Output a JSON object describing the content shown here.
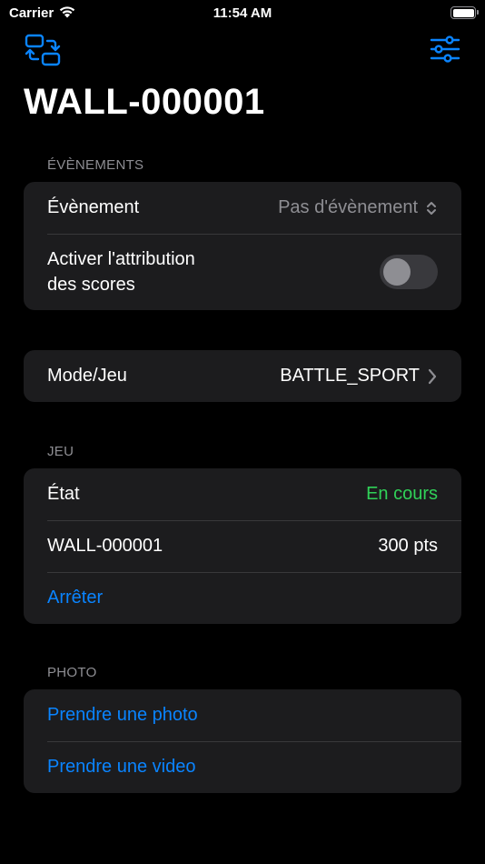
{
  "status_bar": {
    "carrier": "Carrier",
    "time": "11:54 AM"
  },
  "header": {
    "title": "WALL-000001"
  },
  "events": {
    "section_title": "ÉVÈNEMENTS",
    "event_label": "Évènement",
    "event_value": "Pas d'évènement",
    "scoring_label_line1": "Activer l'attribution",
    "scoring_label_line2": "des scores",
    "scoring_enabled": false
  },
  "mode": {
    "label": "Mode/Jeu",
    "value": "BATTLE_SPORT"
  },
  "game": {
    "section_title": "JEU",
    "state_label": "État",
    "state_value": "En cours",
    "wall_label": "WALL-000001",
    "wall_score": "300 pts",
    "stop_action": "Arrêter"
  },
  "photo": {
    "section_title": "PHOTO",
    "take_photo": "Prendre une photo",
    "take_video": "Prendre une video"
  },
  "colors": {
    "accent": "#0a84ff",
    "status_green": "#30d158",
    "secondary_text": "#8e8e93",
    "cell_background": "#1c1c1e"
  },
  "icons": {
    "nav_left": "swap-devices-icon",
    "nav_right": "sliders-icon"
  }
}
